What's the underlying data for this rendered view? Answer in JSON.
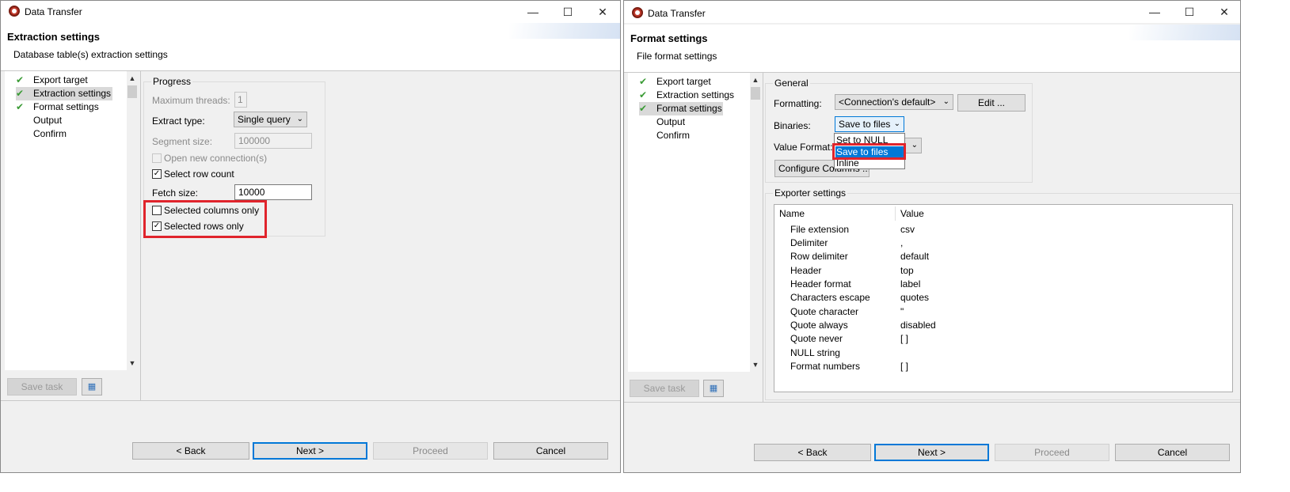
{
  "left": {
    "window_title": "Data Transfer",
    "header_title": "Extraction settings",
    "header_subtitle": "Database table(s) extraction settings",
    "nav": [
      {
        "label": "Export target",
        "checked": true
      },
      {
        "label": "Extraction settings",
        "checked": true
      },
      {
        "label": "Format settings",
        "checked": true
      },
      {
        "label": "Output",
        "checked": false
      },
      {
        "label": "Confirm",
        "checked": false
      }
    ],
    "progress_group": "Progress",
    "max_threads_label": "Maximum threads:",
    "max_threads_value": "1",
    "extract_type_label": "Extract type:",
    "extract_type_value": "Single query",
    "segment_size_label": "Segment size:",
    "segment_size_value": "100000",
    "open_new_connection": "Open new connection(s)",
    "select_row_count": "Select row count",
    "fetch_size_label": "Fetch size:",
    "fetch_size_value": "10000",
    "selected_columns_only": "Selected columns only",
    "selected_rows_only": "Selected rows only",
    "save_task": "Save task",
    "back": "< Back",
    "next": "Next >",
    "proceed": "Proceed",
    "cancel": "Cancel"
  },
  "right": {
    "window_title": "Data Transfer",
    "header_title": "Format settings",
    "header_subtitle": "File format settings",
    "nav": [
      {
        "label": "Export target",
        "checked": true
      },
      {
        "label": "Extraction settings",
        "checked": true
      },
      {
        "label": "Format settings",
        "checked": true
      },
      {
        "label": "Output",
        "checked": false
      },
      {
        "label": "Confirm",
        "checked": false
      }
    ],
    "general_group": "General",
    "formatting_label": "Formatting:",
    "formatting_value": "<Connection's default>",
    "edit_button": "Edit ...",
    "binaries_label": "Binaries:",
    "binaries_value": "Save to files",
    "binaries_options": [
      "Set to NULL",
      "Save to files",
      "Inline"
    ],
    "value_format_label": "Value Format:",
    "configure_columns": "Configure Columns ...",
    "exporter_group": "Exporter settings",
    "col_name": "Name",
    "col_value": "Value",
    "rows": [
      {
        "name": "File extension",
        "value": "csv"
      },
      {
        "name": "Delimiter",
        "value": ","
      },
      {
        "name": "Row delimiter",
        "value": "default"
      },
      {
        "name": "Header",
        "value": "top"
      },
      {
        "name": "Header format",
        "value": "label"
      },
      {
        "name": "Characters escape",
        "value": "quotes"
      },
      {
        "name": "Quote character",
        "value": "\""
      },
      {
        "name": "Quote always",
        "value": "disabled"
      },
      {
        "name": "Quote never",
        "value": "[ ]"
      },
      {
        "name": "NULL string",
        "value": ""
      },
      {
        "name": "Format numbers",
        "value": "[ ]"
      }
    ],
    "save_task": "Save task",
    "back": "< Back",
    "next": "Next >",
    "proceed": "Proceed",
    "cancel": "Cancel"
  },
  "colors": {
    "highlight": "#e0242c",
    "selection": "#0078d7",
    "check": "#3a9b35"
  }
}
